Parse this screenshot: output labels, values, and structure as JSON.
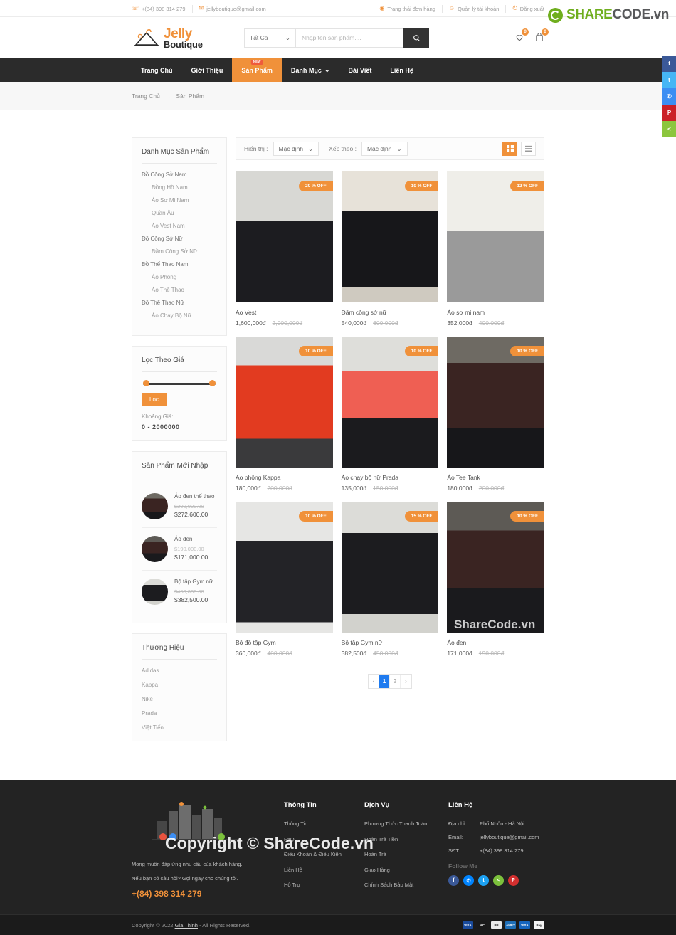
{
  "brandbar": {
    "part1": "SHARE",
    "part2": "CODE.vn",
    "logo_icon": "recycle-icon"
  },
  "topbar": {
    "phone": "+(84) 398 314 279",
    "email": "jellyboutique@gmail.com",
    "order_status": "Trạng thái đơn hàng",
    "account": "Quản lý tài khoản",
    "logout": "Đăng xuất"
  },
  "header": {
    "logo_jelly": "Jelly",
    "logo_boutique": "Boutique",
    "search_category": "Tất Cả",
    "search_placeholder": "Nhập tên sản phẩm....",
    "wishlist_count": "0",
    "cart_count": "0"
  },
  "nav": {
    "items": [
      {
        "label": "Trang Chủ",
        "active": false,
        "badge": "",
        "caret": false
      },
      {
        "label": "Giới Thiệu",
        "active": false,
        "badge": "",
        "caret": false
      },
      {
        "label": "Sản Phẩm",
        "active": true,
        "badge": "NEW",
        "caret": false
      },
      {
        "label": "Danh Mục",
        "active": false,
        "badge": "",
        "caret": true
      },
      {
        "label": "Bài Viết",
        "active": false,
        "badge": "",
        "caret": false
      },
      {
        "label": "Liên Hệ",
        "active": false,
        "badge": "",
        "caret": false
      }
    ]
  },
  "breadcrumb": {
    "home": "Trang Chủ",
    "sep": "→",
    "current": "Sản Phẩm"
  },
  "sidebar": {
    "categories_title": "Danh Mục Sản Phẩm",
    "categories": [
      {
        "label": "Đồ Công Sở Nam",
        "level": 1
      },
      {
        "label": "Đồng Hồ Nam",
        "level": 2
      },
      {
        "label": "Áo Sơ Mi Nam",
        "level": 2
      },
      {
        "label": "Quần Âu",
        "level": 2
      },
      {
        "label": "Áo Vest Nam",
        "level": 2
      },
      {
        "label": "Đồ Công Sở Nữ",
        "level": 1
      },
      {
        "label": "Đầm Công Sở Nữ",
        "level": 2
      },
      {
        "label": "Đồ Thể Thao Nam",
        "level": 1
      },
      {
        "label": "Áo Phông",
        "level": 2
      },
      {
        "label": "Áo Thể Thao",
        "level": 2
      },
      {
        "label": "Đồ Thể Thao Nữ",
        "level": 1
      },
      {
        "label": "Áo Chạy Bộ Nữ",
        "level": 2
      }
    ],
    "price_filter": {
      "title": "Lọc Theo Giá",
      "button": "Lọc",
      "range_label": "Khoảng Giá:",
      "range_value": "0 - 2000000"
    },
    "new_products": {
      "title": "Sản Phẩm Mới Nhập",
      "items": [
        {
          "name": "Áo đen thể thao",
          "old": "$290,000.00",
          "new": "$272,600.00"
        },
        {
          "name": "Áo đen",
          "old": "$190,000.00",
          "new": "$171,000.00"
        },
        {
          "name": "Bộ tập Gym nữ",
          "old": "$450,000.00",
          "new": "$382,500.00"
        }
      ]
    },
    "brands": {
      "title": "Thương Hiệu",
      "items": [
        "Adidas",
        "Kappa",
        "Nike",
        "Prada",
        "Việt Tiến"
      ]
    }
  },
  "toolbar": {
    "show_label": "Hiển thị :",
    "show_value": "Mặc định",
    "sort_label": "Xếp theo :",
    "sort_value": "Mặc định",
    "grid_icon": "grid-view-icon",
    "list_icon": "list-view-icon",
    "active_view": "grid"
  },
  "products": [
    {
      "name": "Áo Vest",
      "price": "1,600,000đ",
      "old_price": "2,000,000đ",
      "discount": "20 % OFF"
    },
    {
      "name": "Đầm công sở nữ",
      "price": "540,000đ",
      "old_price": "600,000đ",
      "discount": "10 % OFF"
    },
    {
      "name": "Áo sơ mi nam",
      "price": "352,000đ",
      "old_price": "400,000đ",
      "discount": "12 % OFF"
    },
    {
      "name": "Áo phông Kappa",
      "price": "180,000đ",
      "old_price": "200,000đ",
      "discount": "10 % OFF"
    },
    {
      "name": "Áo chạy bộ nữ Prada",
      "price": "135,000đ",
      "old_price": "150,000đ",
      "discount": "10 % OFF"
    },
    {
      "name": "Áo Tee Tank",
      "price": "180,000đ",
      "old_price": "200,000đ",
      "discount": "10 % OFF"
    },
    {
      "name": "Bộ đồ tập Gym",
      "price": "360,000đ",
      "old_price": "400,000đ",
      "discount": "10 % OFF"
    },
    {
      "name": "Bộ tập Gym nữ",
      "price": "382,500đ",
      "old_price": "450,000đ",
      "discount": "15 % OFF"
    },
    {
      "name": "Áo đen",
      "price": "171,000đ",
      "old_price": "190,000đ",
      "discount": "10 % OFF"
    }
  ],
  "pagination": {
    "prev": "‹",
    "pages": [
      "1",
      "2"
    ],
    "next": "›",
    "active": "1"
  },
  "footer": {
    "tagline1": "Mong muốn đáp ứng nhu cầu của khách hàng.",
    "tagline2": "Nếu bạn có câu hỏi? Gọi ngay cho chúng tôi.",
    "phone": "+(84) 398 314 279",
    "col_info_title": "Thông Tin",
    "col_info": [
      "Thông Tin",
      "FaQ",
      "Điều Khoản & Điều Kiện",
      "Liên Hệ",
      "Hỗ Trợ"
    ],
    "col_service_title": "Dịch Vụ",
    "col_service": [
      "Phương Thức Thanh Toán",
      "Hoàn Trả Tiền",
      "Hoàn Trả",
      "Giao Hàng",
      "Chính Sách Bảo Mật"
    ],
    "col_contact_title": "Liên Hệ",
    "address_key": "Địa chỉ:",
    "address_val": "Phố Nhổn - Hà Nội",
    "email_key": "Email:",
    "email_val": "jellyboutique@gmail.com",
    "phone_key": "SĐT:",
    "phone_val": "+(84) 398 314 279",
    "follow": "Follow Me",
    "socials": [
      {
        "name": "facebook-icon",
        "glyph": "f",
        "color": "#3b5998"
      },
      {
        "name": "messenger-icon",
        "glyph": "✆",
        "color": "#0084ff"
      },
      {
        "name": "twitter-icon",
        "glyph": "t",
        "color": "#1da1f2"
      },
      {
        "name": "share-icon",
        "glyph": "<",
        "color": "#7cc13c"
      },
      {
        "name": "pinterest-icon",
        "glyph": "P",
        "color": "#d32f2f"
      }
    ]
  },
  "copyright": {
    "prefix": "Copyright © 2022",
    "link": "Gia Thinh",
    "suffix": "- All Rights Reserved.",
    "payments": [
      {
        "name": "visa-icon",
        "label": "VISA",
        "color": "#1a4b9c"
      },
      {
        "name": "mastercard-icon",
        "label": "MC",
        "color": "#1a1a1a"
      },
      {
        "name": "paypal-icon",
        "label": "PP",
        "color": "#eaeaea"
      },
      {
        "name": "amex-icon",
        "label": "AMEX",
        "color": "#1e6fb8"
      },
      {
        "name": "visa-electron-icon",
        "label": "VISA",
        "color": "#1565c0"
      },
      {
        "name": "applepay-icon",
        "label": "Pay",
        "color": "#f2f2f2"
      }
    ]
  },
  "share_rail": [
    {
      "name": "facebook-icon",
      "glyph": "f",
      "color": "#3b5998"
    },
    {
      "name": "twitter-icon",
      "glyph": "t",
      "color": "#46b6f5"
    },
    {
      "name": "messenger-icon",
      "glyph": "✆",
      "color": "#3c8ef3"
    },
    {
      "name": "pinterest-icon",
      "glyph": "P",
      "color": "#cb2027"
    },
    {
      "name": "share-icon",
      "glyph": "<",
      "color": "#8cc63e"
    }
  ],
  "watermarks": {
    "mid": "ShareCode.vn",
    "big": "Copyright © ShareCode.vn"
  }
}
